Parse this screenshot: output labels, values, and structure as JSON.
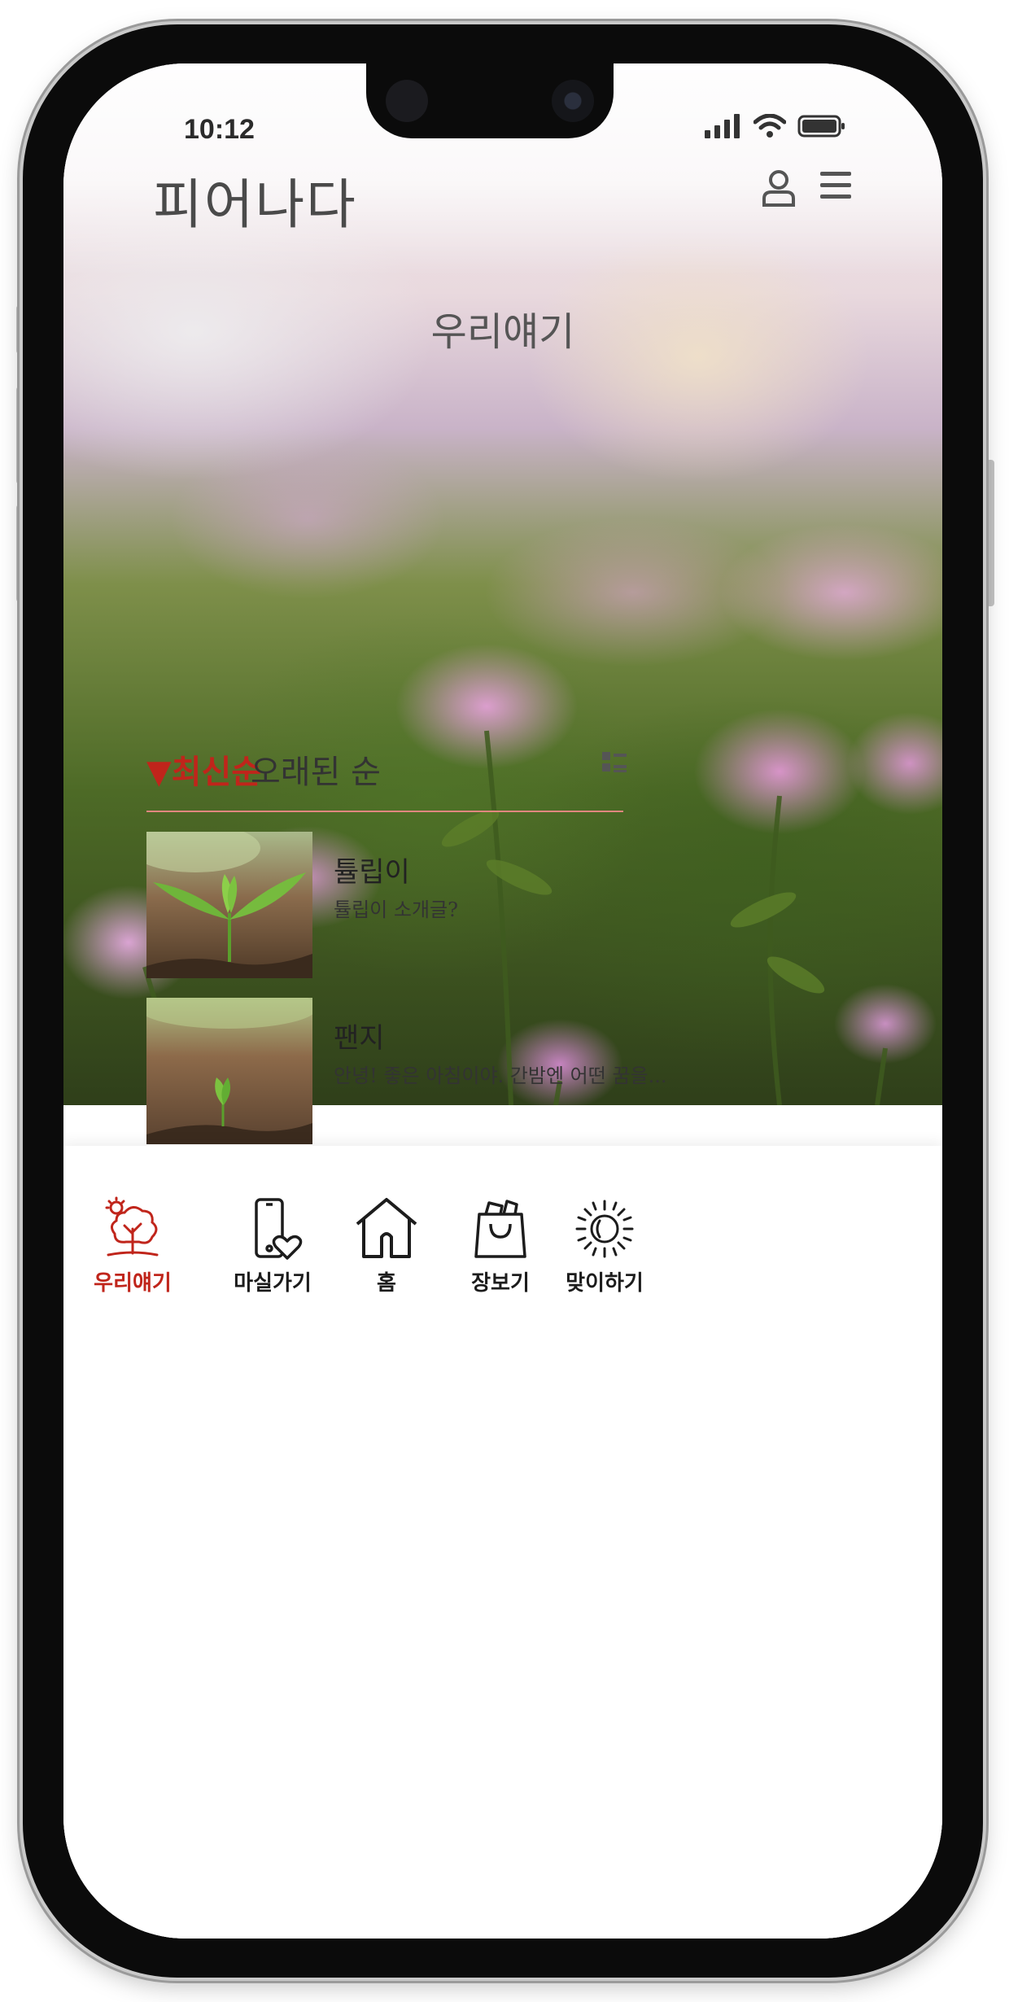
{
  "status_bar": {
    "time": "10:12"
  },
  "header": {
    "app_title": "피어나다",
    "hero_label": "우리얘기"
  },
  "sort": {
    "active_label": "▼최신순",
    "other_label": "오래된 순"
  },
  "posts": [
    {
      "title": "튤립이",
      "excerpt": "튤립이 소개글?"
    },
    {
      "title": "팬지",
      "excerpt": "안녕! 좋은 아침이야. 간밤엔 어떤 꿈을..."
    }
  ],
  "bottom_nav": {
    "items": [
      {
        "label": "우리얘기",
        "icon": "tree-icon",
        "active": true
      },
      {
        "label": "마실가기",
        "icon": "phone-heart-icon",
        "active": false
      },
      {
        "label": "홈",
        "icon": "home-icon",
        "active": false
      },
      {
        "label": "장보기",
        "icon": "shopping-bag-icon",
        "active": false
      },
      {
        "label": "맞이하기",
        "icon": "sun-icon",
        "active": false
      }
    ]
  },
  "colors": {
    "accent": "#c0251b",
    "divider": "#e0877f",
    "text": "#222222"
  }
}
